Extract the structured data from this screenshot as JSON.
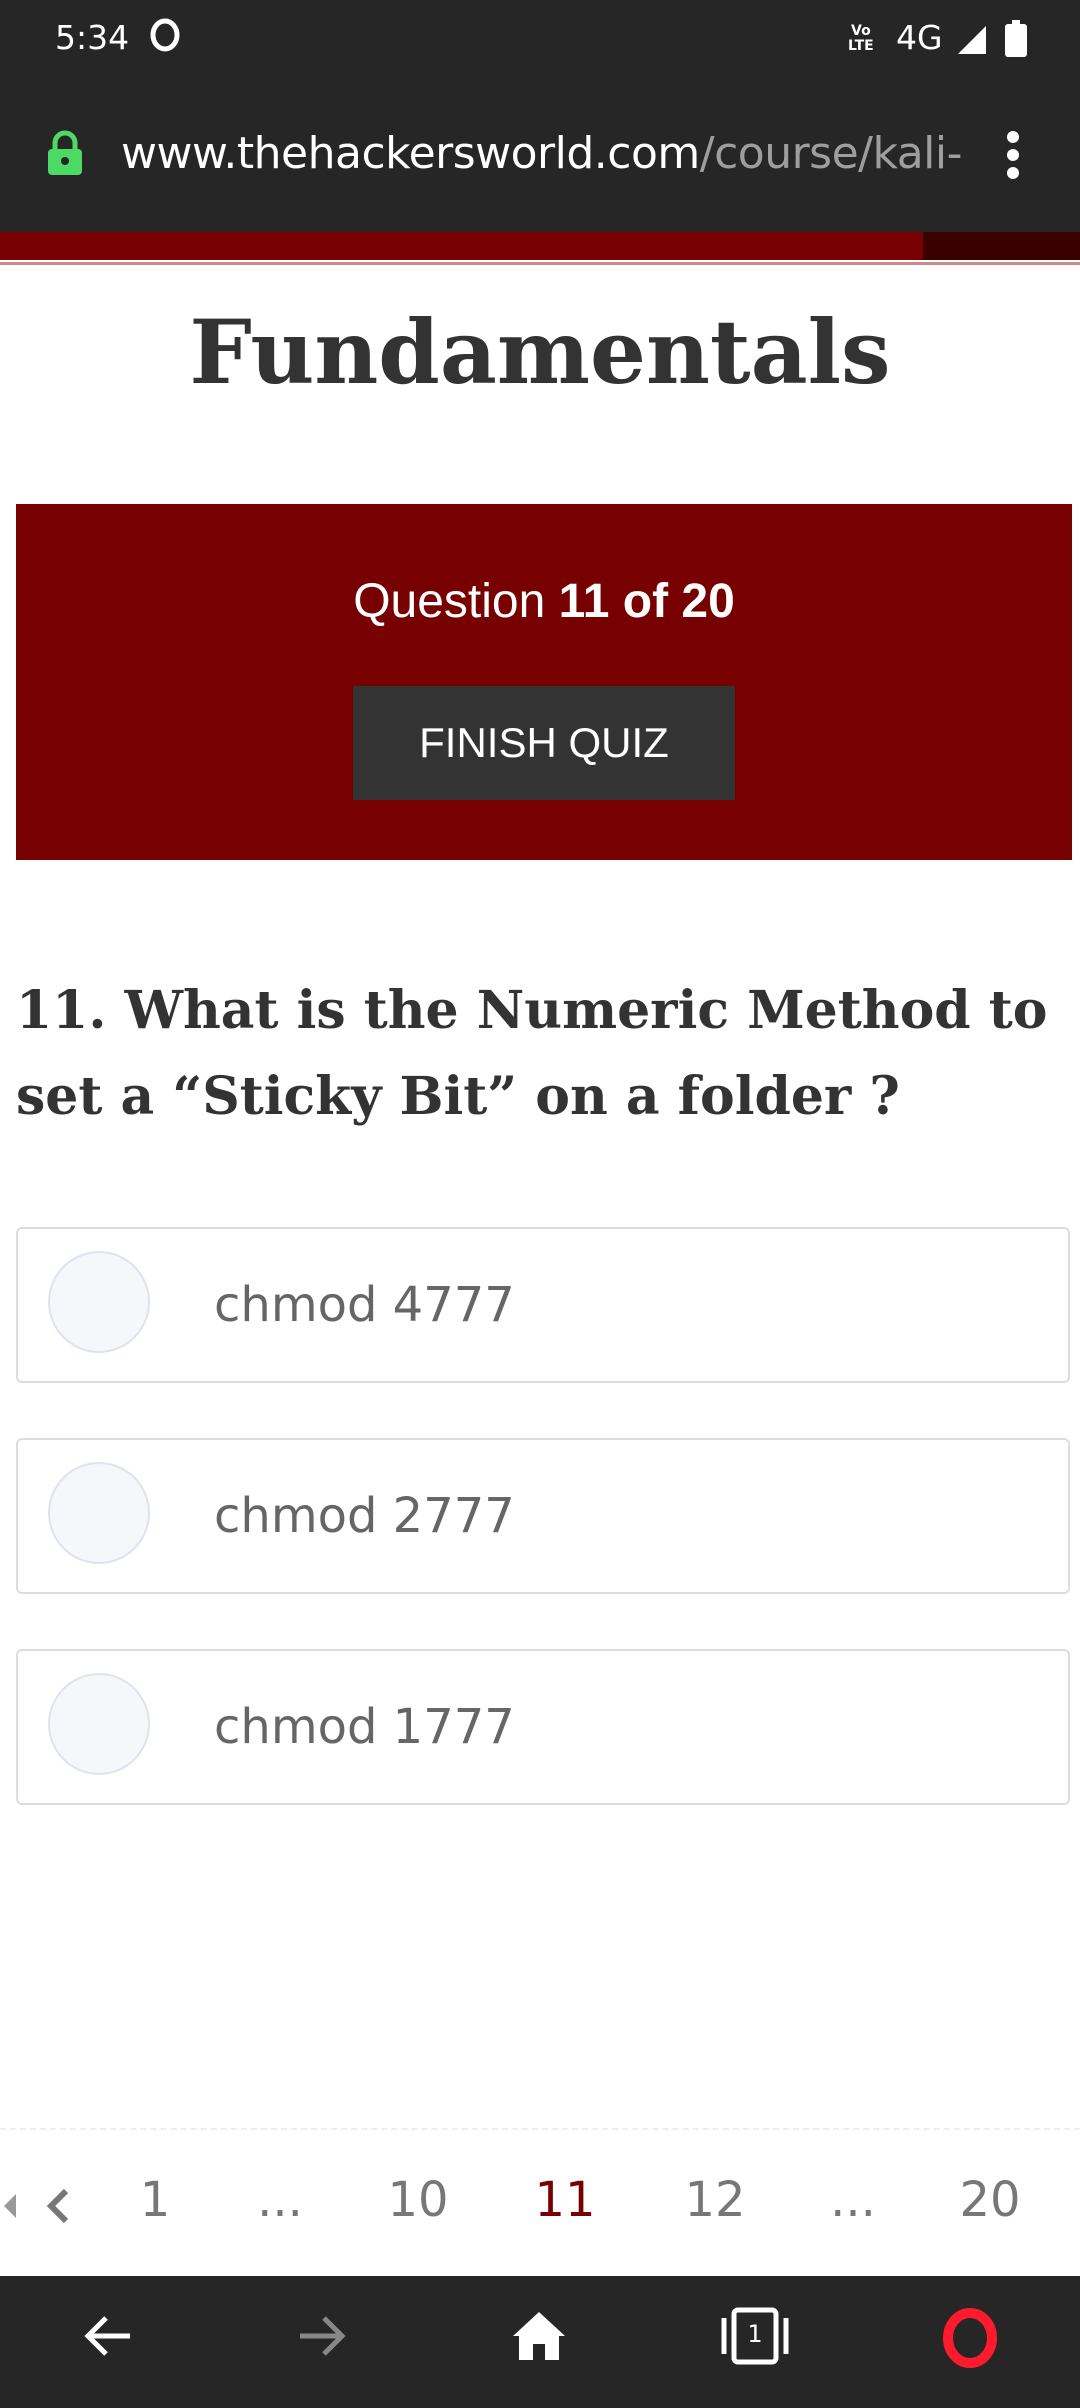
{
  "status_bar": {
    "time": "5:34",
    "volte": "Vo\nLTE",
    "network": "4G"
  },
  "browser": {
    "url_domain": "www.thehackersworld.com",
    "url_path": "/course/kali-lin",
    "tab_count": "1"
  },
  "page": {
    "title": "Fundamentals"
  },
  "quiz": {
    "counter_prefix": "Question",
    "counter_current": "11 of 20",
    "finish_label": "FINISH QUIZ",
    "question": "11. What is the Numeric Method to set a “Sticky Bit” on a folder ?",
    "options": [
      {
        "label": "chmod 4777"
      },
      {
        "label": "chmod 2777"
      },
      {
        "label": "chmod 1777"
      }
    ]
  },
  "pagination": {
    "items": [
      "1",
      "...",
      "10",
      "11",
      "12",
      "...",
      "20"
    ],
    "current": "11"
  },
  "colors": {
    "brand_red": "#770000",
    "dark_bar": "#262626",
    "lock_green": "#4cd964",
    "opera_red": "#ff1b2d"
  }
}
